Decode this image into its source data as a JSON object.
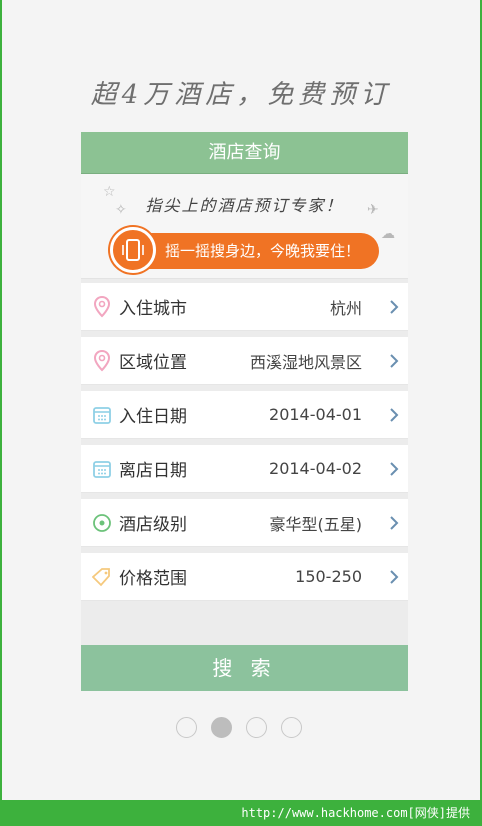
{
  "slogan": "超4万酒店，免费预订",
  "card": {
    "header_title": "酒店查询",
    "tagline": "指尖上的酒店预订专家！",
    "shake_text": "摇一摇搜身边，今晚我要住！",
    "shake_icon": "phone-shake-icon"
  },
  "fields": [
    {
      "label": "入住城市",
      "value": "杭州",
      "icon": "location-pin-icon"
    },
    {
      "label": "区域位置",
      "value": "西溪湿地风景区",
      "icon": "location-pin-icon"
    },
    {
      "label": "入住日期",
      "value": "2014-04-01",
      "icon": "calendar-icon"
    },
    {
      "label": "离店日期",
      "value": "2014-04-02",
      "icon": "calendar-icon"
    },
    {
      "label": "酒店级别",
      "value": "豪华型(五星)",
      "icon": "star-circle-icon"
    },
    {
      "label": "价格范围",
      "value": "150-250",
      "icon": "price-tag-icon"
    }
  ],
  "search_label": "搜 索",
  "pager": {
    "total": 4,
    "active_index": 1
  },
  "footer_text": "http://www.hackhome.com[网侠]提供",
  "colors": {
    "header_green": "#8cc293",
    "button_green": "#8cc29d",
    "accent_orange": "#f07324",
    "frame_green": "#3db13d",
    "chevron_blue": "#6a8fb0"
  }
}
